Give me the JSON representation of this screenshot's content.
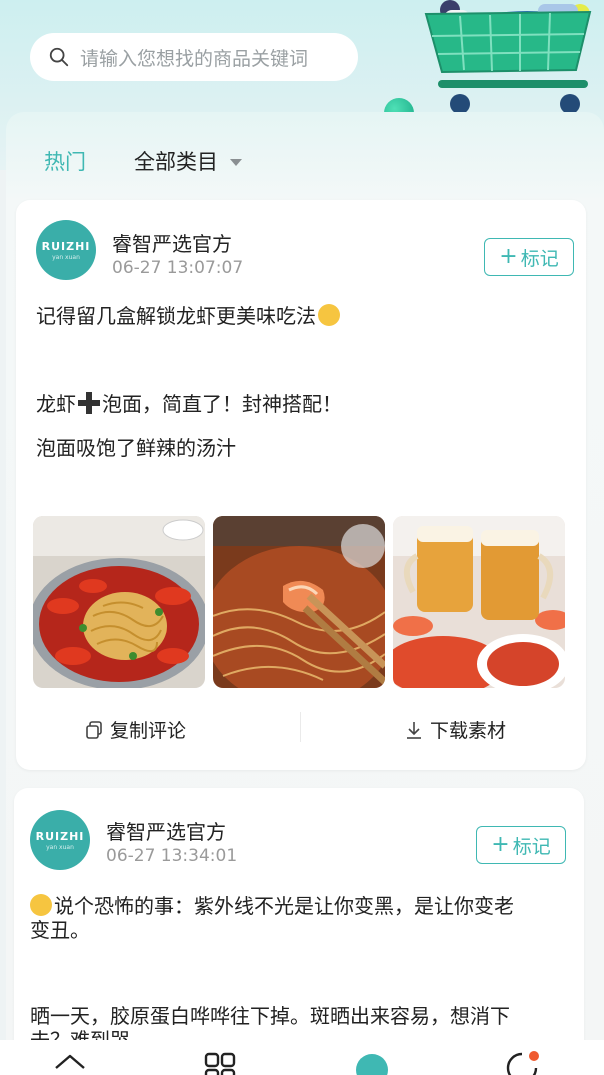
{
  "search": {
    "placeholder": "请输入您想找的商品关键词"
  },
  "categories": {
    "hot": "热门",
    "all": "全部类目"
  },
  "posts": [
    {
      "avatar": {
        "main": "RUIZHI",
        "sub": "yan xuan"
      },
      "author": "睿智严选官方",
      "time": "06-27 13:07:07",
      "mark_label": "标记",
      "lines": [
        "记得留几盒解锁龙虾更美味吃法",
        "龙虾",
        "泡面，简直了！封神搭配！",
        "泡面吸饱了鲜辣的汤汁"
      ],
      "images": [
        "crawfish-noodle-pot",
        "crawfish-chopsticks",
        "beer-and-crawfish"
      ],
      "actions": {
        "copy": "复制评论",
        "download": "下载素材"
      }
    },
    {
      "avatar": {
        "main": "RUIZHI",
        "sub": "yan xuan"
      },
      "author": "睿智严选官方",
      "time": "06-27 13:34:01",
      "mark_label": "标记",
      "lines": [
        "说个恐怖的事：紫外线不光是让你变黑，是让你变老",
        "变丑。",
        "晒一天，胶原蛋白哗哗往下掉。斑晒出来容易，想消下",
        "去？难到哭。"
      ]
    }
  ],
  "bottom_nav": [
    "home-icon",
    "category-icon",
    "discover-icon",
    "message-icon"
  ],
  "colors": {
    "accent": "#3fb8b3",
    "avatar": "#3aaea9",
    "page_bg": "#eef3f4"
  }
}
